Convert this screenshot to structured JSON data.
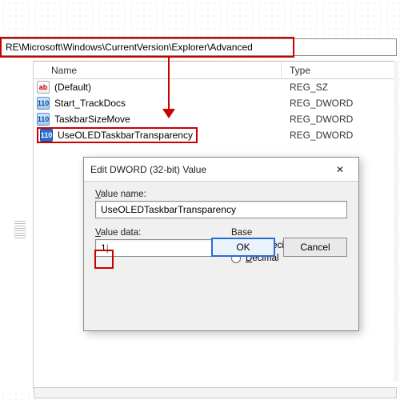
{
  "address": "RE\\Microsoft\\Windows\\CurrentVersion\\Explorer\\Advanced",
  "columns": {
    "name": "Name",
    "type": "Type"
  },
  "rows": [
    {
      "icon": "str",
      "name": "(Default)",
      "type": "REG_SZ"
    },
    {
      "icon": "dw",
      "name": "Start_TrackDocs",
      "type": "REG_DWORD"
    },
    {
      "icon": "dw",
      "name": "TaskbarSizeMove",
      "type": "REG_DWORD"
    },
    {
      "icon": "sel",
      "name": "UseOLEDTaskbarTransparency",
      "type": "REG_DWORD",
      "highlight": true
    }
  ],
  "dialog": {
    "title": "Edit DWORD (32-bit) Value",
    "value_name_label": "Value name:",
    "value_name": "UseOLEDTaskbarTransparency",
    "value_data_label": "Value data:",
    "value_data": "1",
    "base_label": "Base",
    "hex_label": "Hexadecimal",
    "dec_label": "Decimal",
    "ok": "OK",
    "cancel": "Cancel"
  }
}
